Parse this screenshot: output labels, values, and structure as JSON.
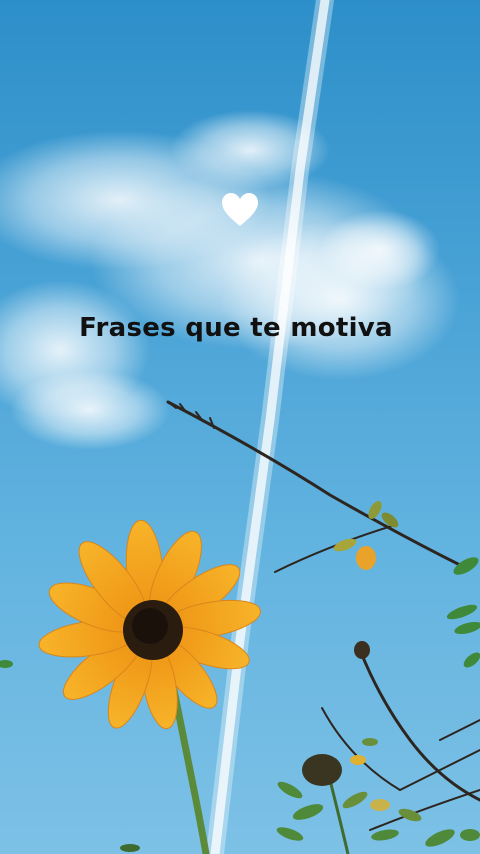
{
  "overlay": {
    "title": "Frases que te motiva",
    "icon": "heart-icon"
  },
  "colors": {
    "sky": "#4aa3d6",
    "title_text": "#111111",
    "heart": "#ffffff",
    "petal": "#f2a51c",
    "flower_center": "#2a1d10"
  }
}
